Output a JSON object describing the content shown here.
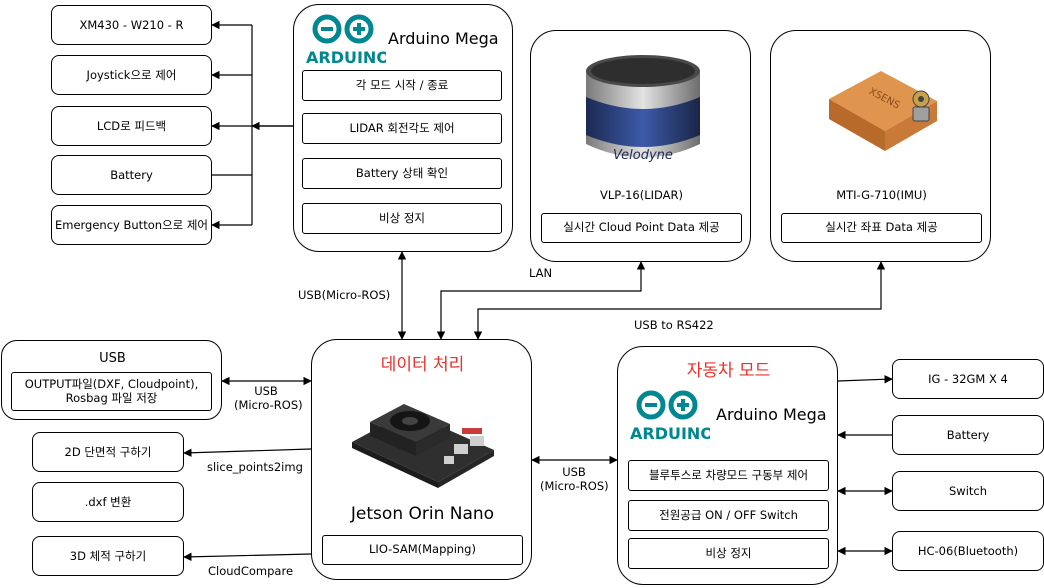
{
  "left_items": [
    "XM430 - W210 - R",
    "Joystick으로 제어",
    "LCD로 피드백",
    "Battery",
    "Emergency Button으로 제어"
  ],
  "mega_top": {
    "logo_text": "ARDUINO",
    "title": "Arduino Mega",
    "items": [
      "각 모드 시작 / 종료",
      "LIDAR 회전각도 제어",
      "Battery 상태 확인",
      "비상 정지"
    ]
  },
  "lidar": {
    "brand": "Velodyne",
    "caption": "VLP-16(LIDAR)",
    "item": "실시간 Cloud Point Data 제공"
  },
  "imu": {
    "brand": "XSENS",
    "caption": "MTI-G-710(IMU)",
    "item": "실시간 좌표 Data 제공"
  },
  "links": {
    "usb_micro_ros_top": "USB(Micro-ROS)",
    "lan": "LAN",
    "usb_rs422": "USB to RS422",
    "usb_left_1": "USB",
    "usb_left_2": "(Micro-ROS)",
    "usb_right_1": "USB",
    "usb_right_2": "(Micro-ROS)",
    "slice": "slice_points2img",
    "cloudcompare": "CloudCompare"
  },
  "usb_box": {
    "title": "USB",
    "item": "OUTPUT파일(DXF, Cloudpoint), Rosbag 파일 저장"
  },
  "outputs": [
    "2D 단면적 구하기",
    ".dxf 변환",
    "3D 체적 구하기"
  ],
  "jetson": {
    "header": "데이터 처리",
    "name": "Jetson Orin Nano",
    "item": "LIO-SAM(Mapping)"
  },
  "auto": {
    "header": "자동차 모드",
    "logo_text": "ARDUINO",
    "title": "Arduino Mega",
    "items": [
      "블루투스로 차량모드 구동부 제어",
      "전원공급 ON / OFF Switch",
      "비상 정지"
    ]
  },
  "right_items": [
    "IG - 32GM  X  4",
    "Battery",
    "Switch",
    "HC-06(Bluetooth)"
  ],
  "colors": {
    "arduino": "#00878f",
    "accent_red": "#e8322b",
    "line": "#000000"
  }
}
